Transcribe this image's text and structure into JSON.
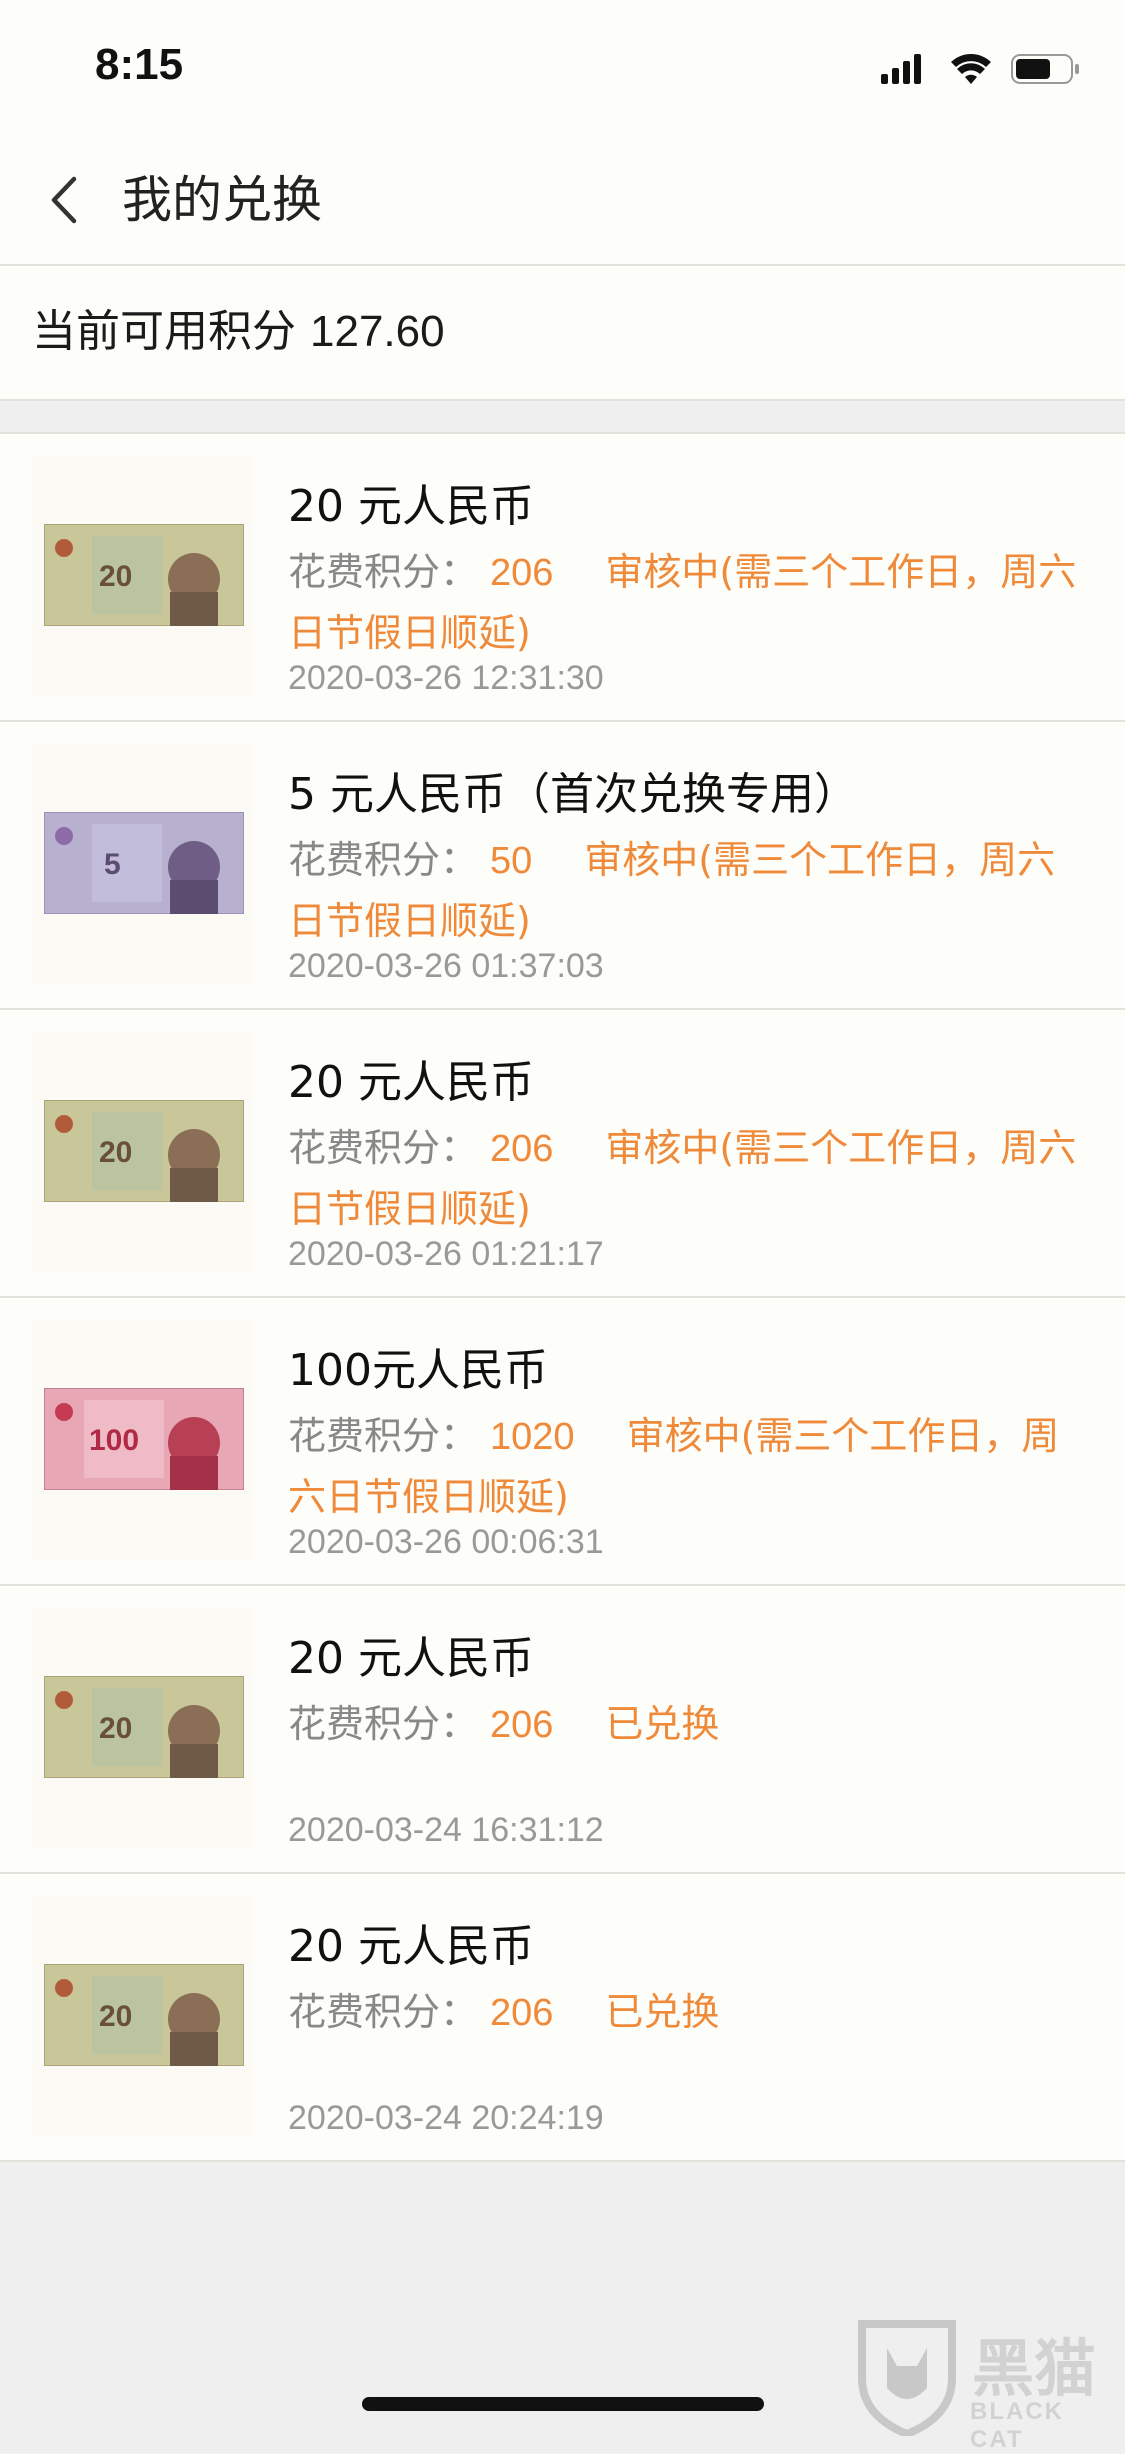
{
  "status_bar": {
    "time": "8:15"
  },
  "nav": {
    "title": "我的兑换"
  },
  "points": {
    "label": "当前可用积分",
    "value": "127.60"
  },
  "theme": {
    "accent": "#ee8a3a",
    "bg": "#fdfdf9"
  },
  "items": [
    {
      "title": "20 元人民币",
      "cost_label": "花费积分：",
      "cost": "206",
      "status": "审核中(需三个工作日，周六日节假日顺延)",
      "time": "2020-03-26 12:31:30",
      "note": "20-yuan-banknote"
    },
    {
      "title": "5 元人民币（首次兑换专用）",
      "cost_label": "花费积分：",
      "cost": "50",
      "status": "审核中(需三个工作日，周六日节假日顺延)",
      "time": "2020-03-26 01:37:03",
      "note": "5-yuan-banknote"
    },
    {
      "title": "20 元人民币",
      "cost_label": "花费积分：",
      "cost": "206",
      "status": "审核中(需三个工作日，周六日节假日顺延)",
      "time": "2020-03-26 01:21:17",
      "note": "20-yuan-banknote"
    },
    {
      "title": "100元人民币",
      "cost_label": "花费积分：",
      "cost": "1020",
      "status": "审核中(需三个工作日，周六日节假日顺延)",
      "time": "2020-03-26 00:06:31",
      "note": "100-yuan-banknote"
    },
    {
      "title": "20 元人民币",
      "cost_label": "花费积分：",
      "cost": "206",
      "status": "已兑换",
      "time": "2020-03-24 16:31:12",
      "note": "20-yuan-banknote"
    },
    {
      "title": "20 元人民币",
      "cost_label": "花费积分：",
      "cost": "206",
      "status": "已兑换",
      "time": "2020-03-24 20:24:19",
      "note": "20-yuan-banknote"
    }
  ],
  "watermark": {
    "text": "黑猫",
    "sub": "BLACK CAT"
  }
}
